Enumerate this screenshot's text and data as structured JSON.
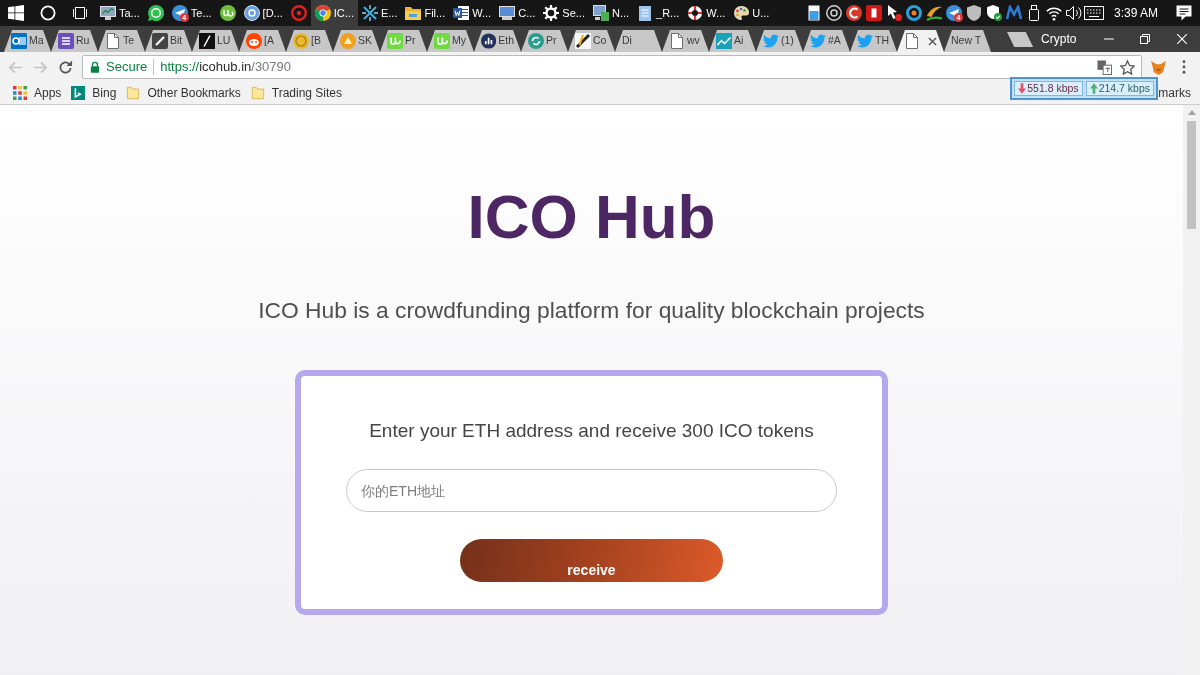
{
  "taskbar": {
    "apps": [
      {
        "label": "Ta...",
        "active": false
      },
      {
        "active": false
      },
      {
        "label": "Te...",
        "active": false,
        "badge": "4"
      },
      {
        "active": false
      },
      {
        "label": "[D...",
        "active": false
      },
      {
        "active": false
      },
      {
        "label": "IC...",
        "active": true
      },
      {
        "label": "E...",
        "active": false
      },
      {
        "label": "Fil...",
        "active": false
      },
      {
        "label": "W...",
        "active": false
      },
      {
        "label": "C...",
        "active": false
      },
      {
        "label": "Se...",
        "active": false
      },
      {
        "label": "N...",
        "active": false
      },
      {
        "label": "_R...",
        "active": false
      },
      {
        "label": "W...",
        "active": false
      },
      {
        "label": "U...",
        "active": false
      }
    ],
    "tray_badge": "4",
    "clock": "3:39 AM"
  },
  "tabs": [
    {
      "title": "Ma",
      "selected": false
    },
    {
      "title": "Ru",
      "selected": false
    },
    {
      "title": "Te",
      "selected": false
    },
    {
      "title": "Bit",
      "selected": false
    },
    {
      "title": "LU",
      "selected": false
    },
    {
      "title": "[A",
      "selected": false
    },
    {
      "title": "[B",
      "selected": false
    },
    {
      "title": "SK",
      "selected": false
    },
    {
      "title": "Pr",
      "selected": false
    },
    {
      "title": "My",
      "selected": false
    },
    {
      "title": "Eth",
      "selected": false
    },
    {
      "title": "Pr",
      "selected": false
    },
    {
      "title": "Co",
      "selected": false
    },
    {
      "title": "Di",
      "selected": false
    },
    {
      "title": "wv",
      "selected": false
    },
    {
      "title": "Ai",
      "selected": false
    },
    {
      "title": "(1)",
      "selected": false
    },
    {
      "title": "#A",
      "selected": false
    },
    {
      "title": "TH",
      "selected": false
    },
    {
      "selected": true
    },
    {
      "title": "New T",
      "selected": false
    }
  ],
  "profile": "Crypto",
  "nav_buttons": [
    {
      "kind": "back",
      "disabled": true
    },
    {
      "kind": "forward",
      "disabled": true
    }
  ],
  "address_bar": {
    "security": "Secure",
    "scheme": "https://",
    "host": "icohub.in",
    "path": "/30790"
  },
  "bookmarks": [
    {
      "kind": "apps",
      "label": "Apps"
    },
    {
      "kind": "site",
      "label": "Bing"
    },
    {
      "kind": "folder",
      "label": "Other Bookmarks"
    },
    {
      "kind": "folder",
      "label": "Trading Sites"
    }
  ],
  "other_bookmarks": "marks",
  "speed_meter": {
    "download": "551.8 kbps",
    "upload": "214.7 kbps"
  },
  "page": {
    "title": "ICO Hub",
    "tagline": "ICO Hub is a crowdfunding platform for quality blockchain projects",
    "form": {
      "prompt": "Enter your ETH address and receive 300 ICO tokens",
      "placeholder": "你的ETH地址",
      "button": "receive"
    }
  }
}
